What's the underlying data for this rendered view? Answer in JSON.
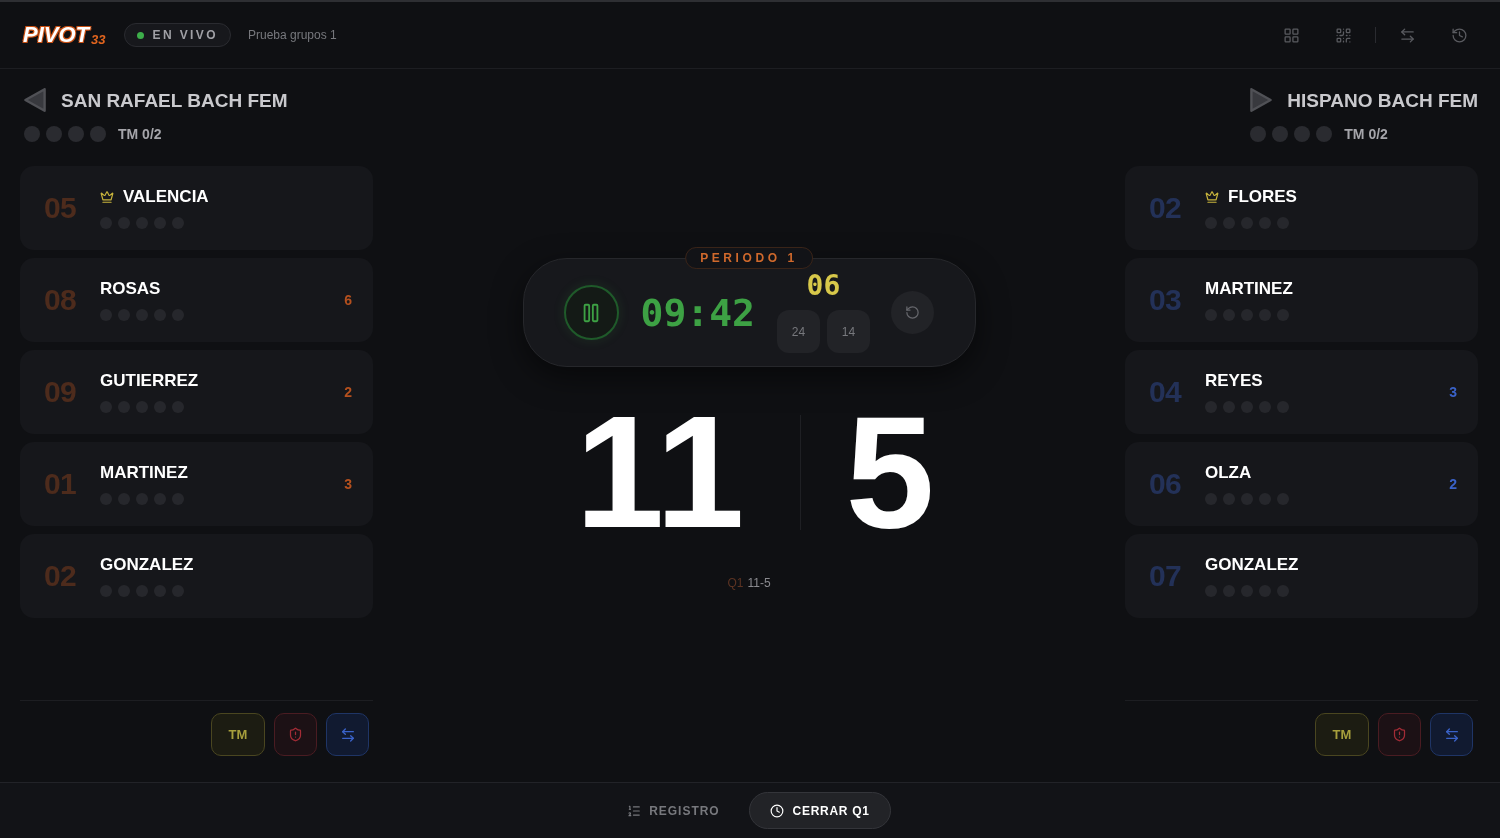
{
  "header": {
    "logo": {
      "word": "PIVOT",
      "number": "33"
    },
    "live_badge": {
      "label": "EN VIVO",
      "live": true
    },
    "match_name": "Prueba grupos 1"
  },
  "teams": [
    {
      "name": "SAN RAFAEL BACH FEM",
      "possession": false,
      "color": "#b4501e",
      "timeout_marks": [
        {
          "on": false
        },
        {
          "on": false
        },
        {
          "on": false
        },
        {
          "on": false
        }
      ],
      "timeouts_label": "TM 0/2",
      "players": [
        {
          "number": "05",
          "name": "VALENCIA",
          "captain": true,
          "fouls": [
            {
              "on": false
            },
            {
              "on": false
            },
            {
              "on": false
            },
            {
              "on": false
            },
            {
              "on": false
            }
          ]
        },
        {
          "number": "08",
          "name": "ROSAS",
          "captain": false,
          "points": "6",
          "fouls": [
            {
              "on": false
            },
            {
              "on": false
            },
            {
              "on": false
            },
            {
              "on": false
            },
            {
              "on": false
            }
          ]
        },
        {
          "number": "09",
          "name": "GUTIERREZ",
          "captain": false,
          "points": "2",
          "fouls": [
            {
              "on": false
            },
            {
              "on": false
            },
            {
              "on": false
            },
            {
              "on": false
            },
            {
              "on": false
            }
          ]
        },
        {
          "number": "01",
          "name": "MARTINEZ",
          "captain": false,
          "points": "3",
          "fouls": [
            {
              "on": false
            },
            {
              "on": false
            },
            {
              "on": false
            },
            {
              "on": false
            },
            {
              "on": false
            }
          ]
        },
        {
          "number": "02",
          "name": "GONZALEZ",
          "captain": false,
          "fouls": [
            {
              "on": false
            },
            {
              "on": false
            },
            {
              "on": false
            },
            {
              "on": false
            },
            {
              "on": false
            }
          ]
        }
      ],
      "timeout_button": "TM"
    },
    {
      "name": "HISPANO BACH FEM",
      "possession": false,
      "color": "#3a62c8",
      "timeout_marks": [
        {
          "on": false
        },
        {
          "on": false
        },
        {
          "on": false
        },
        {
          "on": false
        }
      ],
      "timeouts_label": "TM 0/2",
      "players": [
        {
          "number": "02",
          "name": "FLORES",
          "captain": true,
          "fouls": [
            {
              "on": false
            },
            {
              "on": false
            },
            {
              "on": false
            },
            {
              "on": false
            },
            {
              "on": false
            }
          ]
        },
        {
          "number": "03",
          "name": "MARTINEZ",
          "captain": false,
          "fouls": [
            {
              "on": false
            },
            {
              "on": false
            },
            {
              "on": false
            },
            {
              "on": false
            },
            {
              "on": false
            }
          ]
        },
        {
          "number": "04",
          "name": "REYES",
          "captain": false,
          "points": "3",
          "fouls": [
            {
              "on": false
            },
            {
              "on": false
            },
            {
              "on": false
            },
            {
              "on": false
            },
            {
              "on": false
            }
          ]
        },
        {
          "number": "06",
          "name": "OLZA",
          "captain": false,
          "points": "2",
          "fouls": [
            {
              "on": false
            },
            {
              "on": false
            },
            {
              "on": false
            },
            {
              "on": false
            },
            {
              "on": false
            }
          ]
        },
        {
          "number": "07",
          "name": "GONZALEZ",
          "captain": false,
          "fouls": [
            {
              "on": false
            },
            {
              "on": false
            },
            {
              "on": false
            },
            {
              "on": false
            },
            {
              "on": false
            }
          ]
        }
      ],
      "timeout_button": "TM"
    }
  ],
  "clock": {
    "period_label": "PERIODO 1",
    "running": true,
    "game_time": "09:42",
    "shot_clock": "06",
    "shot_presets": [
      "24",
      "14"
    ]
  },
  "score": {
    "home": "11",
    "away": "5"
  },
  "period_scores": [
    {
      "period": "Q1",
      "score": "11-5"
    }
  ],
  "footer": {
    "log_button": "REGISTRO",
    "close_period_button": "CERRAR Q1"
  }
}
